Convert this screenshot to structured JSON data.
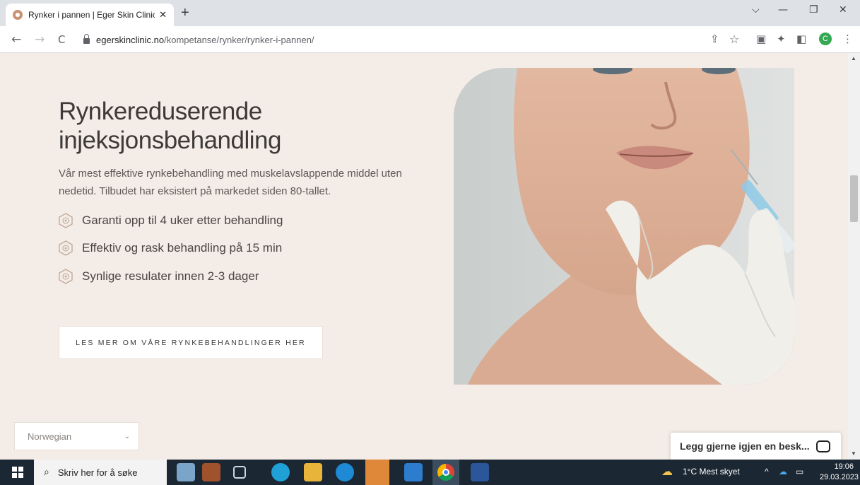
{
  "browser": {
    "tab_title": "Rynker i pannen | Eger Skin Clinic",
    "tab_close": "✕",
    "new_tab": "+",
    "url_domain": "egerskinclinic.no",
    "url_path": "/kompetanse/rynker/rynker-i-pannen/",
    "profile_initial": "C",
    "window_controls": {
      "dropdown": "⌵",
      "minimize": "—",
      "restore": "❐",
      "close": "✕"
    },
    "nav": {
      "back": "←",
      "forward": "→",
      "reload": "C"
    },
    "toolbar_icons": {
      "share": "⇪",
      "bookmark": "☆",
      "extension1": "▣",
      "extensions": "✦",
      "sidebar": "◧",
      "menu": "⋮"
    }
  },
  "hero": {
    "heading": "Rynkereduserende injeksjonsbehandling",
    "intro": "Vår mest effektive rynkebehandling med muskelavslappende middel uten nedetid. Tilbudet har eksistert på markedet siden 80-tallet.",
    "benefits": [
      "Garanti opp til 4 uker etter behandling",
      "Effektiv og rask behandling på 15 min",
      "Synlige resulater innen 2-3 dager"
    ],
    "cta_label": "LES MER OM VÅRE RYNKEBEHANDLINGER HER"
  },
  "language_select": {
    "value": "Norwegian",
    "chevron": "⌄"
  },
  "chat_widget": {
    "text": "Legg gjerne igjen en besk..."
  },
  "taskbar": {
    "search_placeholder": "Skriv her for å søke",
    "search_icon": "⌕",
    "weather": "1°C  Mest skyet",
    "tray_chevron": "^",
    "time": "19:06",
    "date": "29.03.2023"
  },
  "colors": {
    "page_bg": "#f4ece6",
    "heading": "#3d3a38",
    "taskbar": "#1b2733",
    "profile": "#34a853"
  }
}
